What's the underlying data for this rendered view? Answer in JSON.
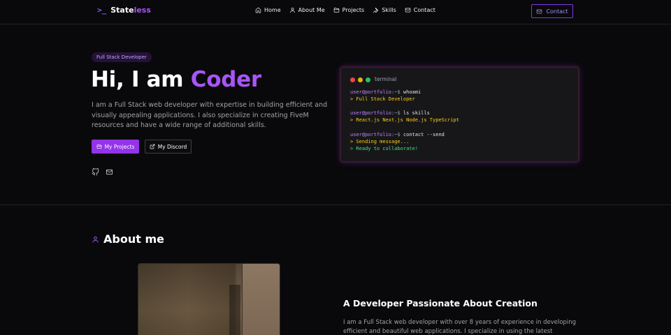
{
  "header": {
    "logo_mark": ">_",
    "logo_main": "State",
    "logo_accent": "less",
    "nav": [
      {
        "label": "Home",
        "icon": "home-icon"
      },
      {
        "label": "About Me",
        "icon": "user-icon"
      },
      {
        "label": "Projects",
        "icon": "folder-icon"
      },
      {
        "label": "Skills",
        "icon": "wrench-icon"
      },
      {
        "label": "Contact",
        "icon": "mail-icon"
      }
    ],
    "contact_button": "Contact"
  },
  "hero": {
    "badge": "Full Stack Developer",
    "title_prefix": "Hi, I am ",
    "title_accent": "Coder",
    "description": "I am a Full Stack web developer with expertise in building efficient and visually appealing applications. I also specialize in creating FiveM resources and have a wide range of additional skills.",
    "primary_button": "My Projects",
    "secondary_button": "My Discord",
    "socials": [
      "github-icon",
      "mail-icon"
    ]
  },
  "terminal": {
    "title": "terminal",
    "user": "user@portfolio",
    "path": ":~$",
    "commands": [
      {
        "cmd": " whoami",
        "output": [
          {
            "text": "> Full Stack Developer",
            "kind": "out"
          }
        ]
      },
      {
        "cmd": " ls skills",
        "output": [
          {
            "text": "> React.js Next.js Node.js TypeScript",
            "kind": "out"
          }
        ]
      },
      {
        "cmd": " contact --send",
        "output": [
          {
            "text": "> Sending message...",
            "kind": "out"
          },
          {
            "text": "> Ready to collaborate!",
            "kind": "ok"
          }
        ]
      }
    ]
  },
  "about": {
    "title": "About me",
    "subtitle": "A Developer Passionate About Creation",
    "text": "I am a Full Stack web developer with over 8 years of experience in developing efficient and beautiful web applications. I specialize in using the latest technologies such as"
  },
  "colors": {
    "accent": "#a855f7",
    "primary_button": "#9333ea",
    "background": "#09090b",
    "terminal_output": "#facc15",
    "terminal_success": "#4ade80"
  }
}
